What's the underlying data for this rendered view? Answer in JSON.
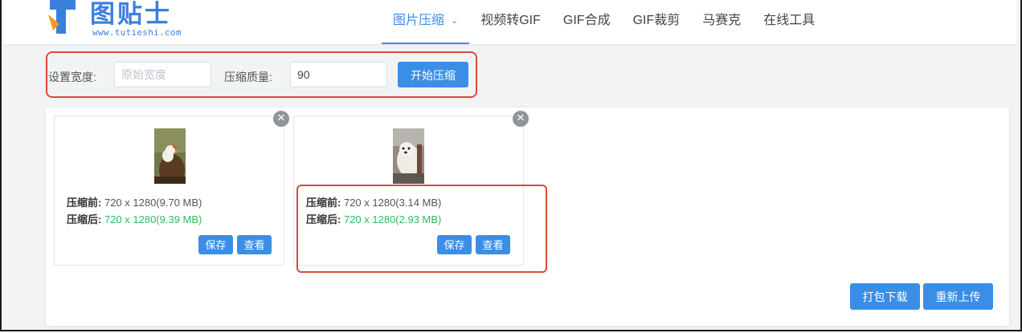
{
  "brand": {
    "name": "图贴士",
    "url": "www.tutieshi.com",
    "color": "#3b7fdc"
  },
  "nav": {
    "items": [
      {
        "label": "图片压缩",
        "active": true,
        "dropdown": true
      },
      {
        "label": "视频转GIF"
      },
      {
        "label": "GIF合成"
      },
      {
        "label": "GIF裁剪"
      },
      {
        "label": "马赛克"
      },
      {
        "label": "在线工具"
      }
    ]
  },
  "settings": {
    "width_label": "设置宽度:",
    "width_placeholder": "原始宽度",
    "width_value": "",
    "quality_label": "压缩质量:",
    "quality_value": "90",
    "start_button": "开始压缩"
  },
  "images": [
    {
      "before_label": "压缩前:",
      "before_value": "720 x 1280(9.70 MB)",
      "after_label": "压缩后:",
      "after_value": "720 x 1280(9.39 MB)",
      "save_label": "保存",
      "view_label": "查看",
      "remove_icon": "close-icon"
    },
    {
      "before_label": "压缩前:",
      "before_value": "720 x 1280(3.14 MB)",
      "after_label": "压缩后:",
      "after_value": "720 x 1280(2.93 MB)",
      "save_label": "保存",
      "view_label": "查看",
      "remove_icon": "close-icon"
    }
  ],
  "actions": {
    "pack_download": "打包下载",
    "reupload": "重新上传"
  },
  "colors": {
    "accent": "#3a8ee6",
    "success": "#2fbb5c",
    "annotation": "#d94b3a"
  }
}
